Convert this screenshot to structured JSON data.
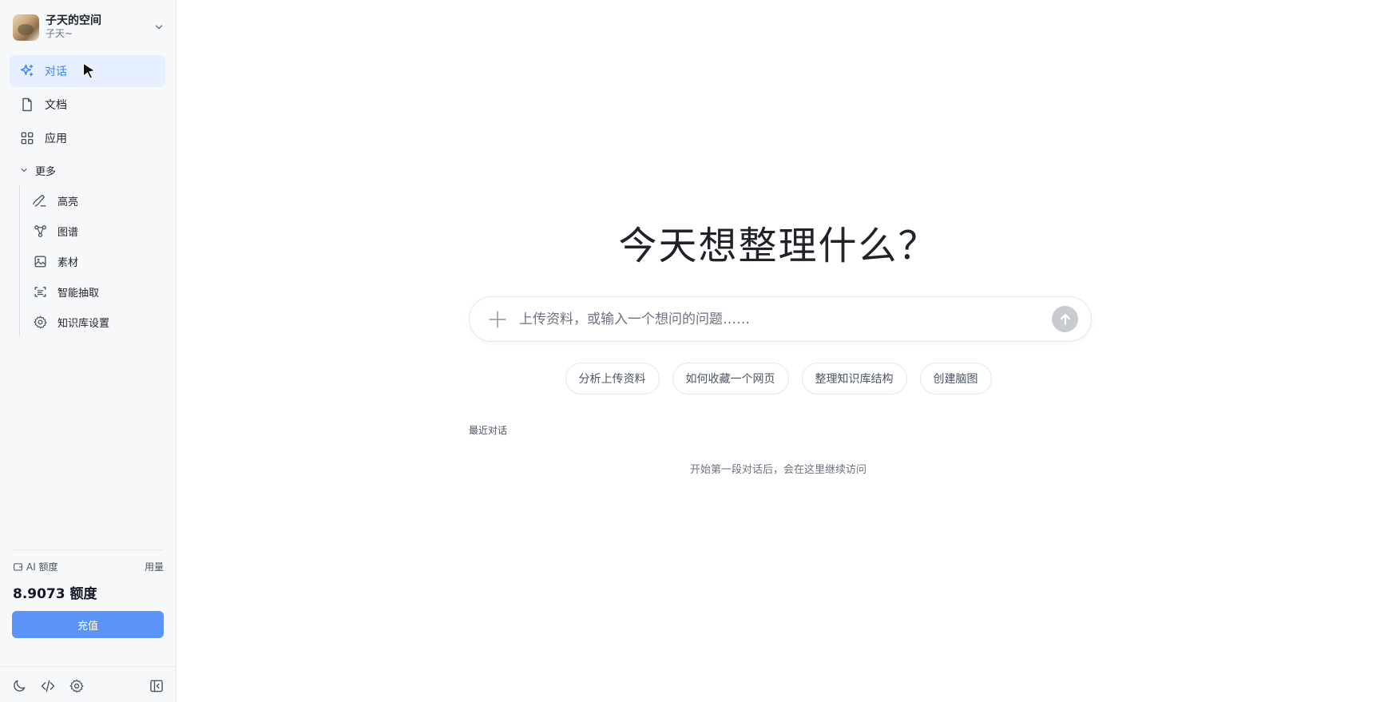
{
  "workspace": {
    "name": "子天的空间",
    "user": "子天~"
  },
  "nav": {
    "items": [
      {
        "label": "对话",
        "icon": "sparkle-icon",
        "active": true
      },
      {
        "label": "文档",
        "icon": "document-icon"
      },
      {
        "label": "应用",
        "icon": "grid-icon"
      }
    ],
    "more_label": "更多",
    "sub_items": [
      {
        "label": "高亮",
        "icon": "highlighter-icon"
      },
      {
        "label": "图谱",
        "icon": "graph-icon"
      },
      {
        "label": "素材",
        "icon": "image-icon"
      },
      {
        "label": "智能抽取",
        "icon": "extract-icon"
      },
      {
        "label": "知识库设置",
        "icon": "gear-icon"
      }
    ]
  },
  "quota": {
    "label": "AI 额度",
    "usage_label": "用量",
    "value": "8.9073 额度",
    "recharge_label": "充值"
  },
  "main": {
    "headline": "今天想整理什么？",
    "input_placeholder": "上传资料，或输入一个想问的问题……",
    "chips": [
      "分析上传资料",
      "如何收藏一个网页",
      "整理知识库结构",
      "创建脑图"
    ],
    "recent_label": "最近对话",
    "empty_hint": "开始第一段对话后，会在这里继续访问"
  },
  "colors": {
    "accent": "#3b82f6",
    "active_bg": "#e6efff",
    "recharge_bg": "#5b93f7",
    "sidebar_bg": "#f7f8fa"
  }
}
